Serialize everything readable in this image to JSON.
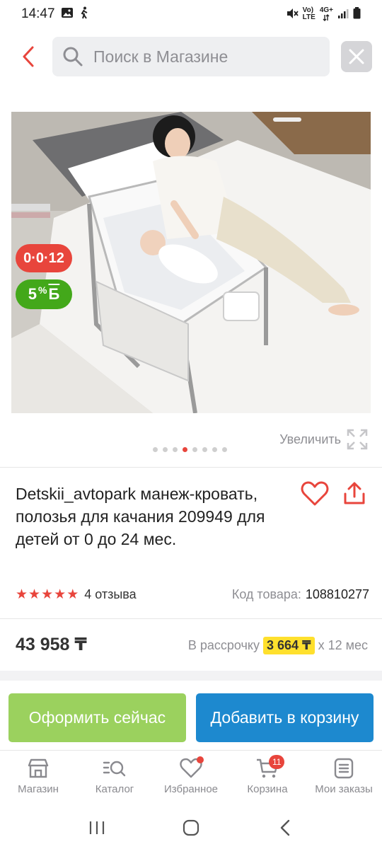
{
  "status_bar": {
    "time": "14:47",
    "network_label_top": "Vo)",
    "network_label_bottom": "LTE",
    "data_label_top": "4G+"
  },
  "search": {
    "placeholder": "Поиск в Магазине"
  },
  "gallery": {
    "badge_age": "0·0·12",
    "badge_bonus_value": "5",
    "badge_bonus_percent": "%",
    "badge_bonus_currency": "Б",
    "dots_count": 8,
    "active_dot": 3,
    "zoom_label": "Увеличить"
  },
  "product": {
    "title": "Detskii_avtopark манеж-кровать, полозья для качания 209949 для детей от 0 до 24 мес.",
    "rating": 5,
    "reviews": "4 отзыва",
    "sku_label": "Код товара:",
    "sku_value": "108810277",
    "price": "43 958 ₸",
    "installment_prefix": "В рассрочку",
    "installment_amount": "3 664 ₸",
    "installment_suffix": "x 12 мес"
  },
  "actions": {
    "buy_now": "Оформить сейчас",
    "add_to_cart": "Добавить в корзину"
  },
  "tabs": [
    {
      "label": "Магазин",
      "icon": "shop-icon"
    },
    {
      "label": "Каталог",
      "icon": "catalog-icon"
    },
    {
      "label": "Избранное",
      "icon": "heart-icon"
    },
    {
      "label": "Корзина",
      "icon": "cart-icon",
      "badge": "11"
    },
    {
      "label": "Мои заказы",
      "icon": "orders-icon"
    }
  ],
  "colors": {
    "accent_red": "#e8453c",
    "bonus_green": "#43a81a",
    "buy_now_green": "#9bd15e",
    "cart_blue": "#1d89cf",
    "installment_yellow": "#ffe02d"
  }
}
